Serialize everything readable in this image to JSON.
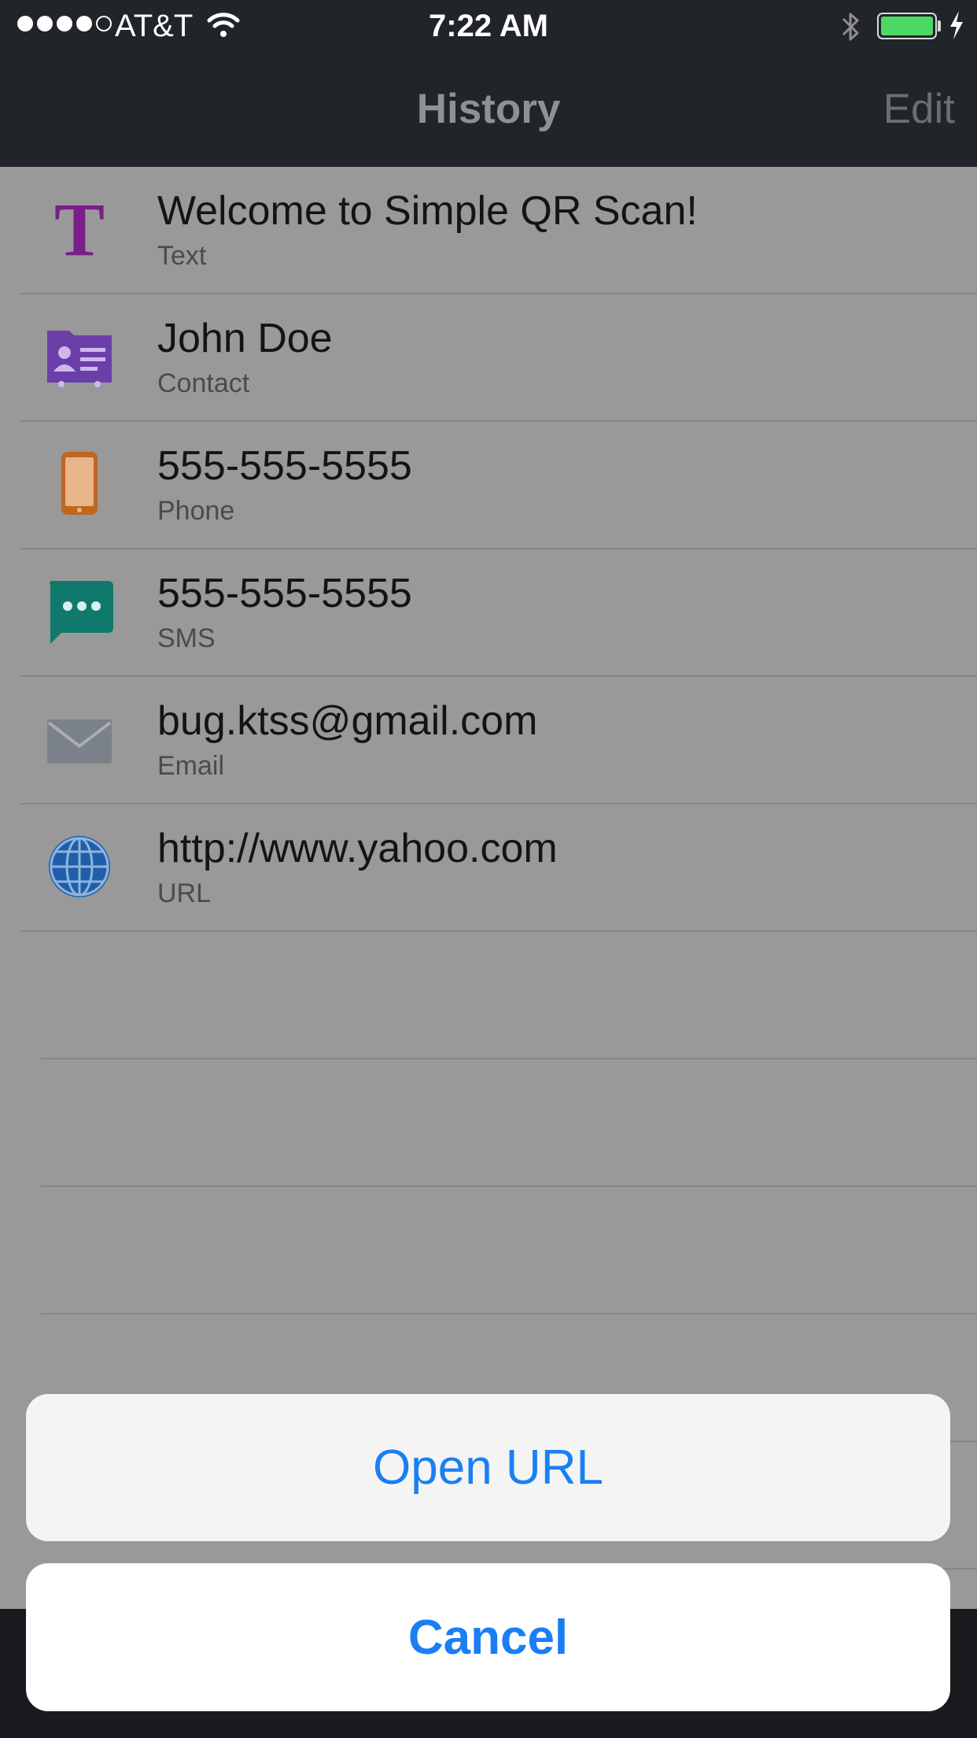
{
  "status_bar": {
    "carrier": "AT&T",
    "time": "7:22 AM",
    "signal_filled": 4,
    "signal_total": 5,
    "battery_level": 1.0,
    "battery_color": "#4cd964",
    "icons": [
      "wifi-icon",
      "bluetooth-icon",
      "battery-icon",
      "charging-bolt-icon"
    ]
  },
  "nav": {
    "title": "History",
    "edit_label": "Edit"
  },
  "history": [
    {
      "title": "Welcome to Simple QR Scan!",
      "type": "Text",
      "icon": "text-icon",
      "color": "#7b1d8a"
    },
    {
      "title": "John Doe",
      "type": "Contact",
      "icon": "contact-card-icon",
      "color": "#6a3fa8"
    },
    {
      "title": "555-555-5555",
      "type": "Phone",
      "icon": "phone-icon",
      "color": "#c2651d"
    },
    {
      "title": "555-555-5555",
      "type": "SMS",
      "icon": "sms-bubble-icon",
      "color": "#0f7a6c"
    },
    {
      "title": "bug.ktss@gmail.com",
      "type": "Email",
      "icon": "envelope-icon",
      "color": "#7b8188"
    },
    {
      "title": "http://www.yahoo.com",
      "type": "URL",
      "icon": "globe-icon",
      "color": "#1f5ea8"
    }
  ],
  "action_sheet": {
    "open_url_label": "Open URL",
    "cancel_label": "Cancel",
    "accent": "#1a7ff2"
  }
}
